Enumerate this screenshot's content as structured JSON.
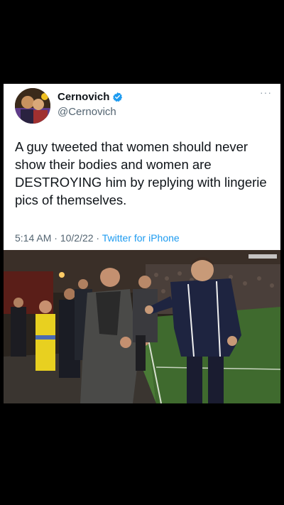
{
  "tweet": {
    "display_name": "Cernovich",
    "handle": "@Cernovich",
    "verified": true,
    "more_label": "···",
    "text": "A guy tweeted that women should never show their bodies and women are DESTROYING him by replying with lingerie pics of themselves.",
    "time": "5:14 AM",
    "separator": " · ",
    "date": "10/2/22",
    "source": "Twitter for iPhone"
  },
  "colors": {
    "verified_badge": "#1d9bf0",
    "link": "#1d9bf0",
    "secondary_text": "#536471"
  },
  "icons": {
    "verified": "verified-badge-icon",
    "more": "more-options-icon"
  },
  "media": {
    "scene": "stadium-sideline-celebration"
  }
}
